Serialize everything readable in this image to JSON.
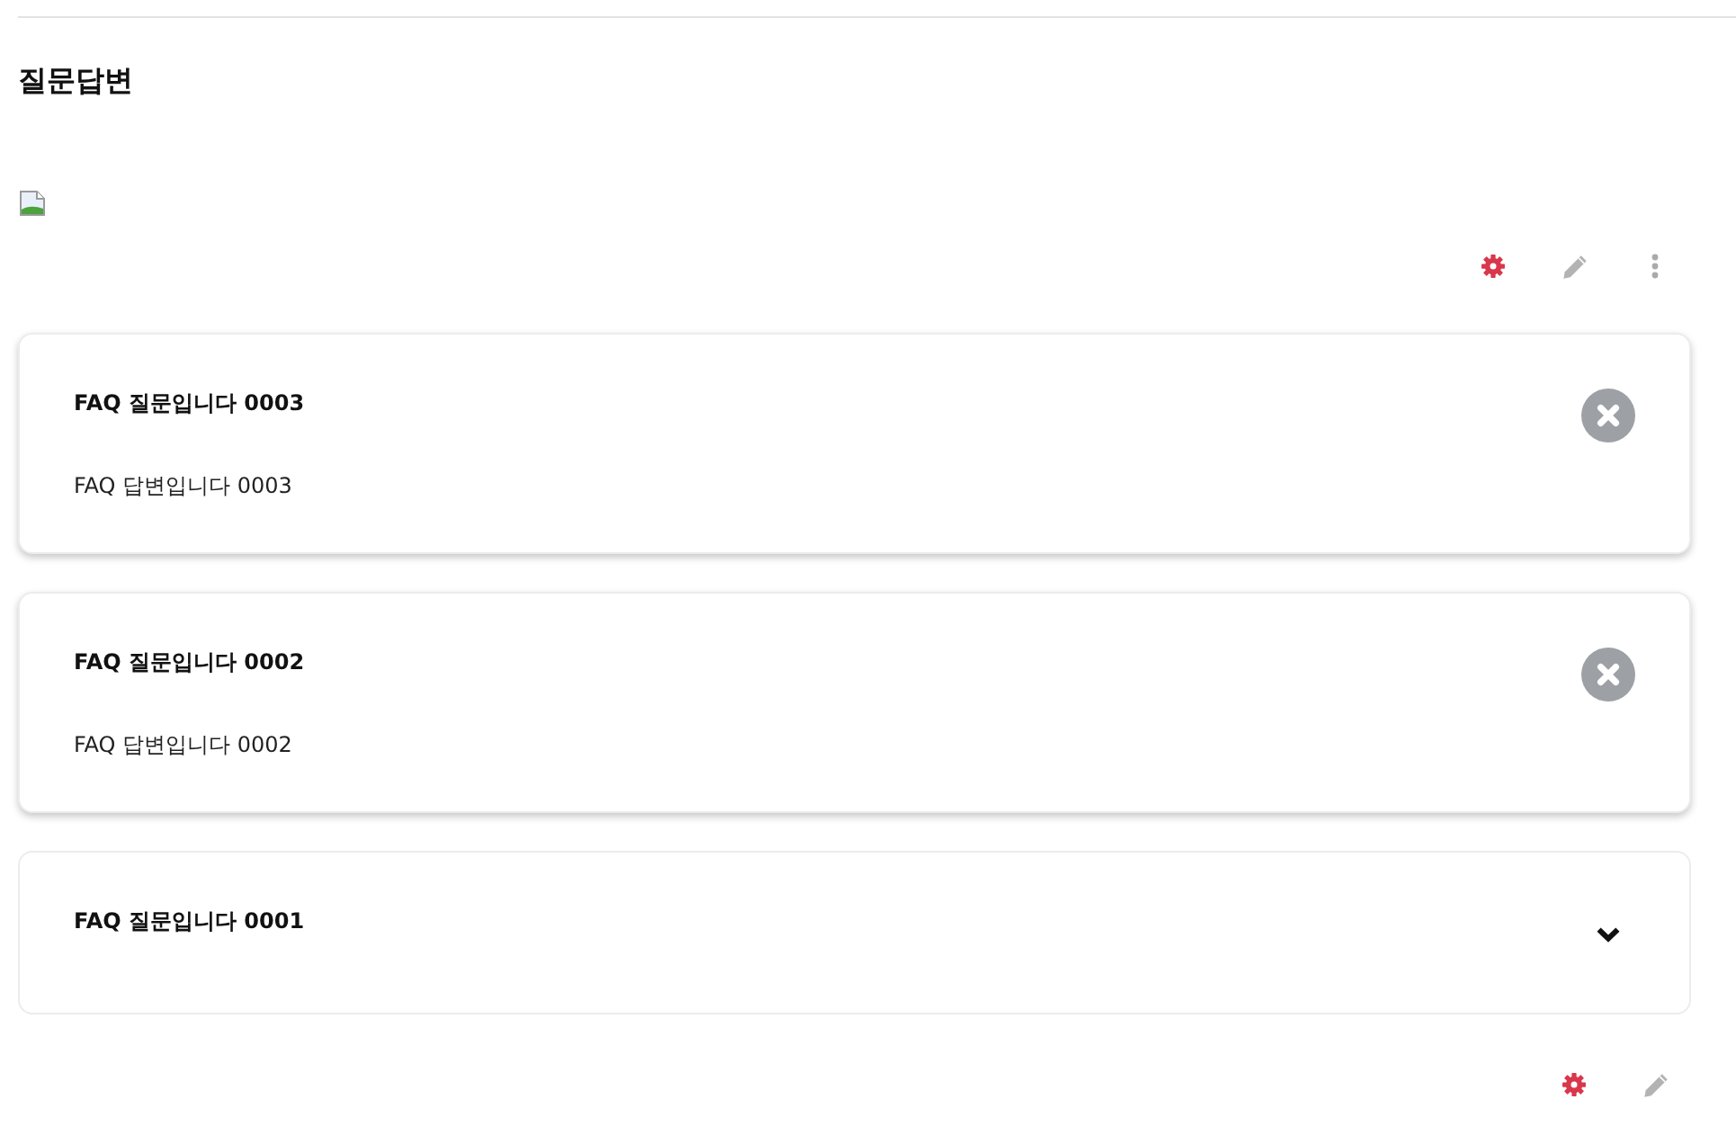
{
  "page": {
    "title": "질문답변"
  },
  "faq": {
    "items": [
      {
        "question": "FAQ 질문입니다 0003",
        "answer": "FAQ 답변입니다 0003",
        "expanded": true
      },
      {
        "question": "FAQ 질문입니다 0002",
        "answer": "FAQ 답변입니다 0002",
        "expanded": true
      },
      {
        "question": "FAQ 질문입니다 0001",
        "expanded": false
      }
    ]
  }
}
